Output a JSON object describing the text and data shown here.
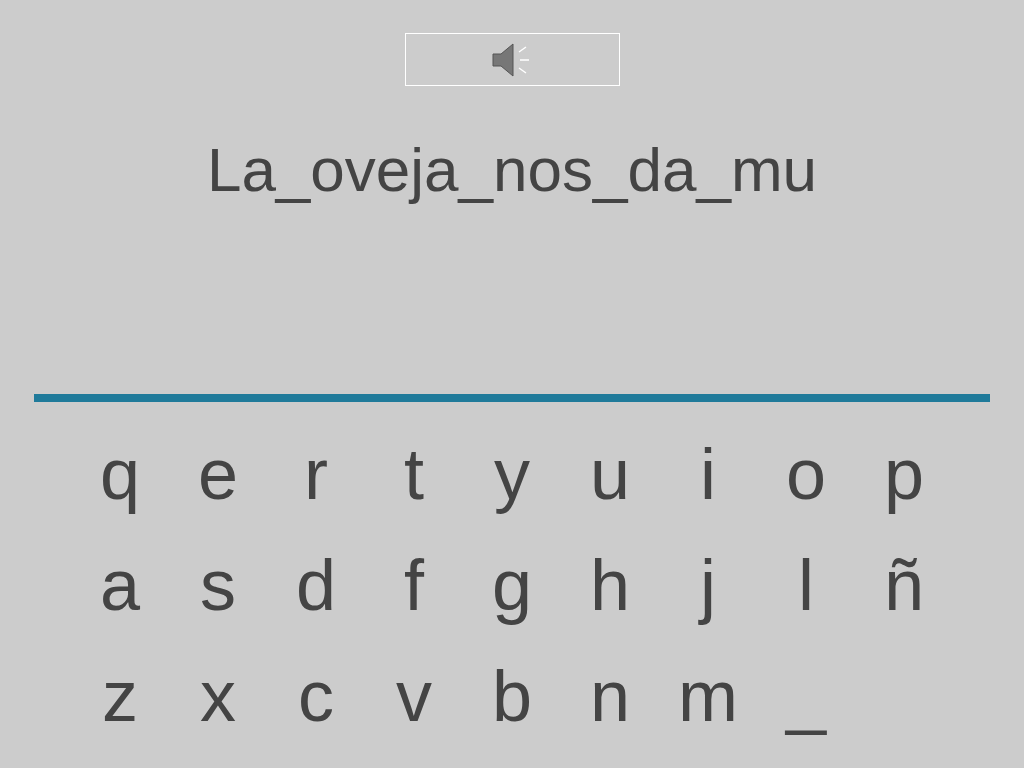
{
  "sentence": "La_oveja_nos_da_mu",
  "keyboard": [
    [
      "q",
      "e",
      "r",
      "t",
      "y",
      "u",
      "i",
      "o",
      "p"
    ],
    [
      "a",
      "s",
      "d",
      "f",
      "g",
      "h",
      "j",
      "l",
      "ñ"
    ],
    [
      "z",
      "x",
      "c",
      "v",
      "b",
      "n",
      "m",
      "_"
    ]
  ]
}
